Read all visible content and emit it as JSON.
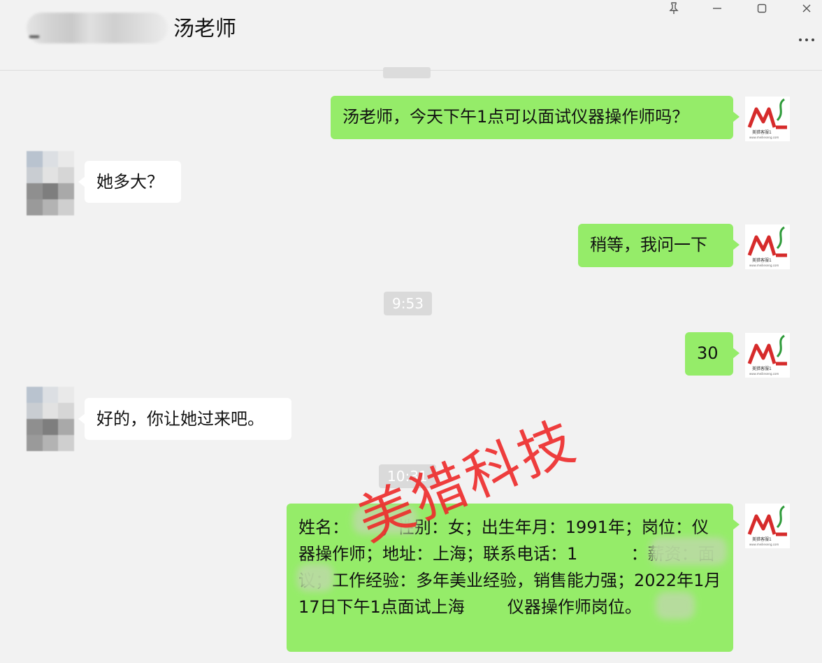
{
  "header": {
    "contact_name": "汤老师",
    "buttons": {
      "pin_icon": "pin-icon",
      "minimize_icon": "minimize-icon",
      "maximize_icon": "maximize-icon",
      "close_icon": "close-icon",
      "more_icon": "more-icon"
    }
  },
  "messages": [
    {
      "type": "sent",
      "text": "汤老师，今天下午1点可以面试仪器操作师吗？"
    },
    {
      "type": "received",
      "text": "她多大？"
    },
    {
      "type": "sent",
      "text": "稍等，我问一下"
    },
    {
      "type": "time",
      "text": "9:53"
    },
    {
      "type": "sent",
      "text": "30"
    },
    {
      "type": "received",
      "text": "好的，你让她过来吧。"
    },
    {
      "type": "time",
      "text": "10:31"
    },
    {
      "type": "sent",
      "text": "姓名：      ；性别：女；出生年月：1991年；岗位：仪器操作师；地址：上海；联系电话：1          ：薪资：面议；工作经验：多年美业经验，销售能力强；2022年1月17日下午1点面试上海        仪器操作师岗位。"
    }
  ],
  "avatar_me": {
    "logo_text": "ML",
    "caption": "美猎客服1",
    "url": "www.meilieseng.com"
  },
  "watermark": "美猎科技",
  "colors": {
    "sent_bubble": "#95ec69",
    "received_bubble": "#ffffff",
    "background": "#f2f2f2",
    "watermark": "#ee2a2a",
    "logo_red": "#d62b2b",
    "logo_green": "#2e9b3a"
  }
}
